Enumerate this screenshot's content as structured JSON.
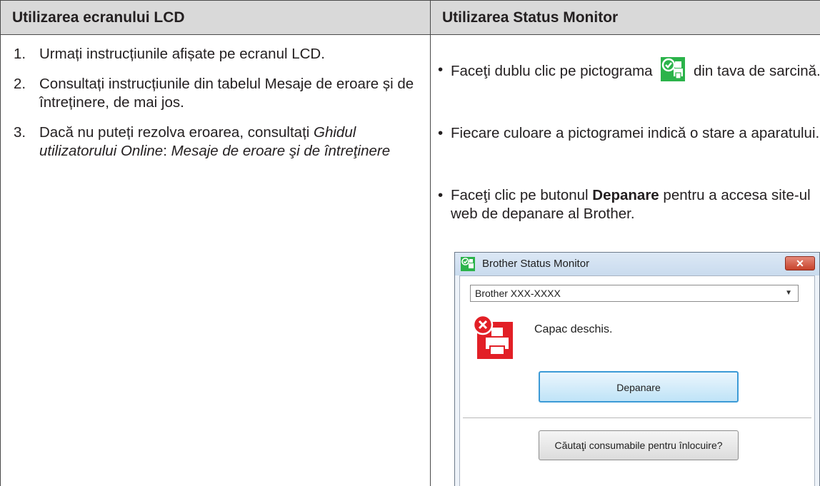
{
  "left": {
    "heading": "Utilizarea ecranului LCD",
    "steps": [
      {
        "num": "1.",
        "text": "Urmați instrucțiunile afișate pe ecranul LCD."
      },
      {
        "num": "2.",
        "text": "Consultați instrucțiunile din tabelul Mesaje de eroare și de întreținere, de mai jos."
      },
      {
        "num": "3.",
        "text_plain": "Dacă nu puteți rezolva eroarea, consultați ",
        "text_italic_1": "Ghidul utilizatorului Online",
        "text_sep": ": ",
        "text_italic_2": "Mesaje de eroare şi de întreţinere"
      }
    ]
  },
  "right": {
    "heading": "Utilizarea Status Monitor",
    "bullets": {
      "b1_before": "Faceţi dublu clic pe pictograma ",
      "b1_after": " din tava de sarcină.",
      "b2": "Fiecare culoare a pictogramei indică o stare a aparatului.",
      "b3_before": "Faceţi clic pe butonul ",
      "b3_bold": "Depanare",
      "b3_after": " pentru a accesa site-ul web de depanare al Brother."
    },
    "window": {
      "title": "Brother Status Monitor",
      "close_label": "✕",
      "selected_printer": "Brother XXX-XXXX",
      "status": "Capac deschis.",
      "troubleshoot_button": "Depanare",
      "supplies_button": "Căutaţi consumabile pentru înlocuire?"
    },
    "icons": {
      "tray_icon": "status-monitor-ok-icon",
      "error_icon": "printer-error-icon",
      "ok_color": "#2bb34a",
      "error_color": "#e21f26"
    }
  }
}
